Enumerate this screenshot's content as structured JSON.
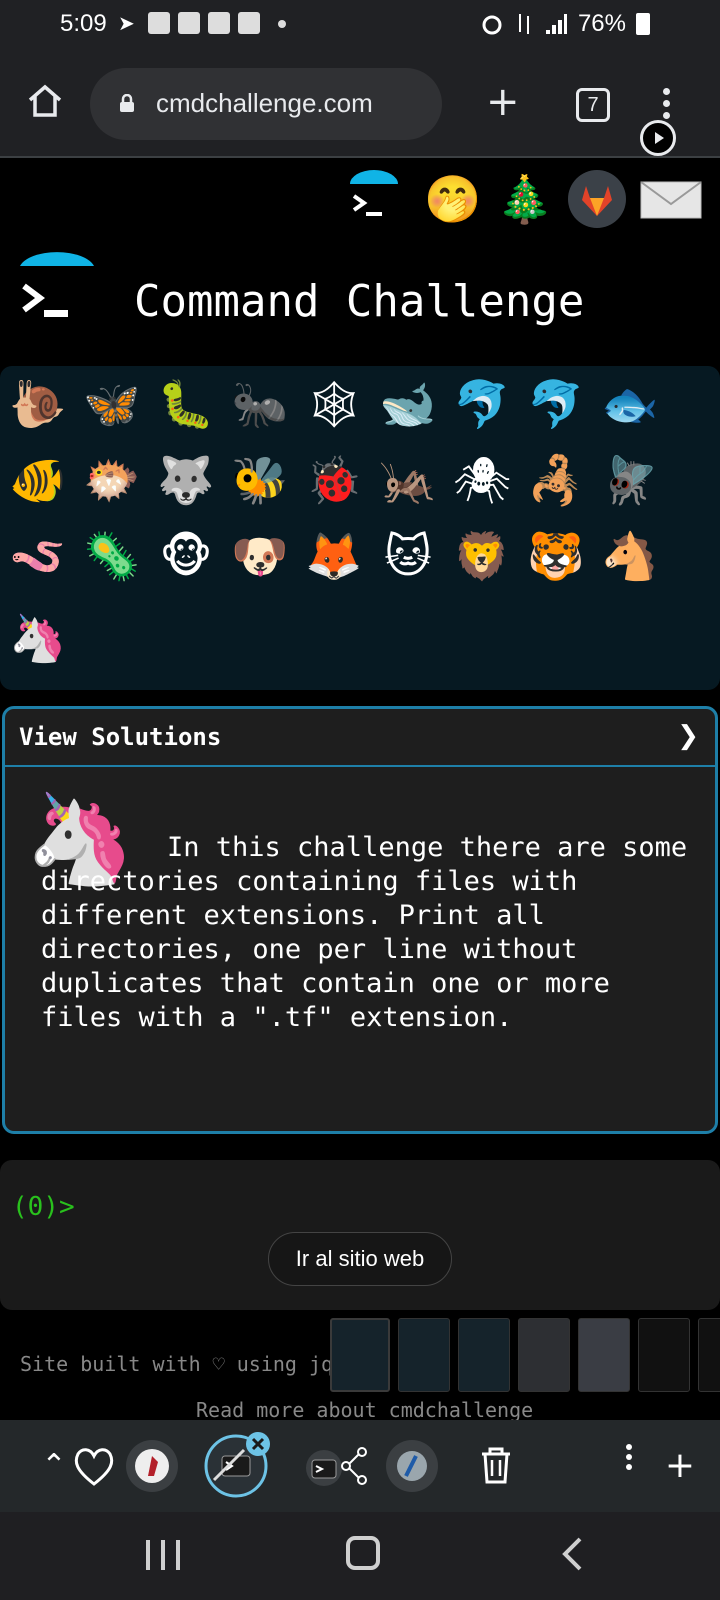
{
  "status_bar": {
    "time": "5:09",
    "battery": "76%"
  },
  "browser": {
    "url": "cmdchallenge.com",
    "tab_count": "7"
  },
  "site": {
    "title": "Command Challenge"
  },
  "challenge_grid": {
    "row1": [
      "🐌",
      "🦋",
      "🐛",
      "🐜",
      "🕸",
      "🐋",
      "🐬",
      "🐬",
      "🐟"
    ],
    "row2": [
      "🐠",
      "🐡",
      "🐺",
      "🐝",
      "🐞",
      "🦗",
      "🕷",
      "🦂",
      "🪰"
    ],
    "row3": [
      "🪱",
      "🦠",
      "🐵",
      "🐶",
      "🦊",
      "🐱",
      "🦁",
      "🐯",
      "🐴"
    ],
    "row4": [
      "🦄"
    ]
  },
  "description": {
    "header": "View Solutions",
    "chevron": "❯",
    "text": "In this challenge there are some directories containing files with different extensions. Print all directories, one per line without duplicates that contain one or more files with a \".tf\" extension."
  },
  "terminal": {
    "prompt": "(0)>",
    "goto_button": "Ir al sitio web"
  },
  "footer": {
    "line1": "Site built with ♡ using jq",
    "line2": "Read more about cmdchallenge"
  },
  "colors": {
    "accent": "#1e7fa8",
    "prompt_green": "#29c11d",
    "grid_bg": "#061922"
  }
}
